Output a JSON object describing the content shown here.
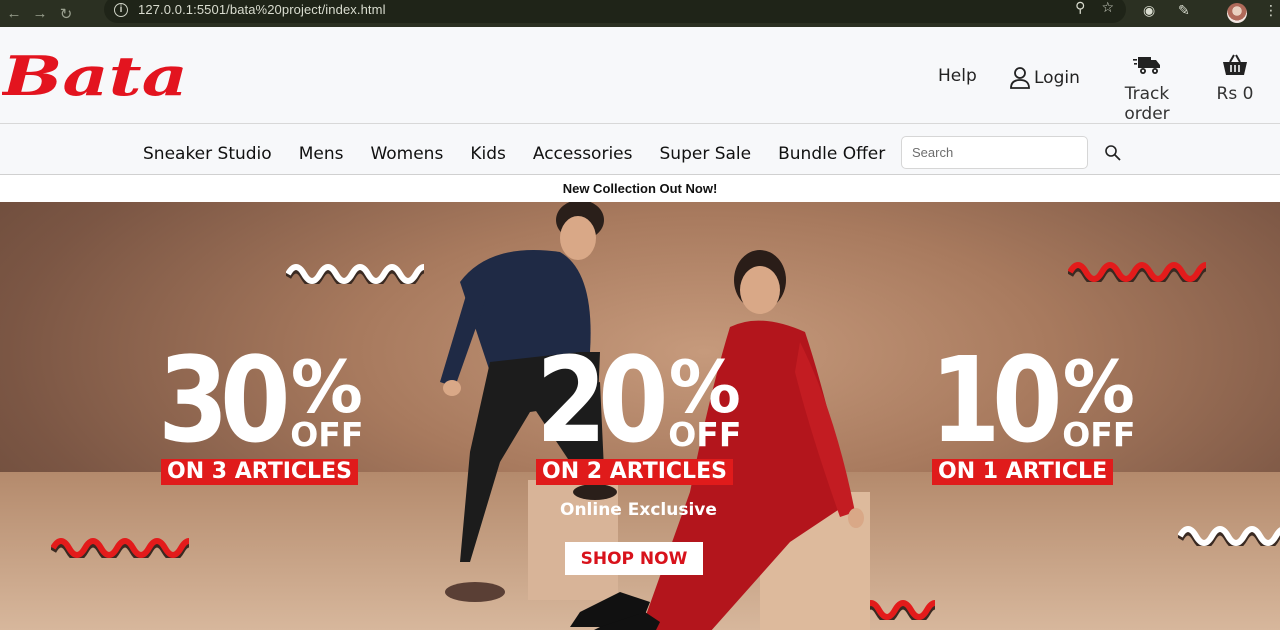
{
  "browser": {
    "url": "127.0.0.1:5501/bata%20project/index.html"
  },
  "header": {
    "logo_text": "Bata",
    "help": "Help",
    "login": "Login",
    "track_order": "Track order",
    "cart_total": "Rs 0"
  },
  "nav": {
    "links": [
      "Sneaker Studio",
      "Mens",
      "Womens",
      "Kids",
      "Accessories",
      "Super Sale",
      "Bundle Offer"
    ],
    "search_placeholder": "Search"
  },
  "announcement": "New Collection Out Now!",
  "hero": {
    "offers": [
      {
        "percent": "30",
        "sign": "%",
        "off": "OFF",
        "tag": "ON 3 ARTICLES"
      },
      {
        "percent": "20",
        "sign": "%",
        "off": "OFF",
        "tag": "ON 2 ARTICLES"
      },
      {
        "percent": "10",
        "sign": "%",
        "off": "OFF",
        "tag": "ON 1 ARTICLE"
      }
    ],
    "subtitle": "Online Exclusive",
    "cta": "SHOP NOW"
  },
  "colors": {
    "brand_red": "#e01b1b",
    "header_bg": "#f7f8fa"
  }
}
